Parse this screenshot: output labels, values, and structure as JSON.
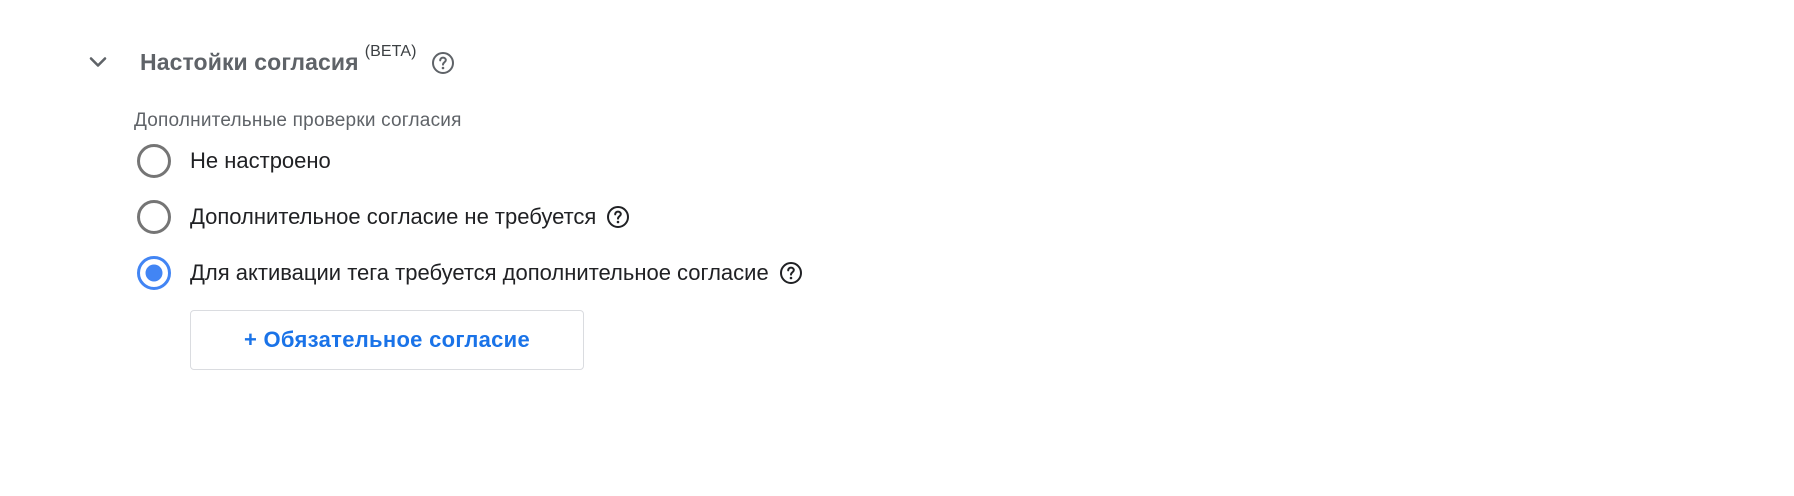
{
  "section": {
    "title": "Настойки согласия",
    "badge": "(BETA)",
    "expanded": true,
    "icons": {
      "toggle": "chevron-down-icon",
      "help": "help-circle-icon"
    }
  },
  "consent_checks": {
    "label": "Дополнительные проверки согласия",
    "selected_index": 2,
    "options": [
      {
        "label": "Не настроено",
        "selected": false,
        "has_help": false
      },
      {
        "label": "Дополнительное согласие не требуется",
        "selected": false,
        "has_help": true
      },
      {
        "label": "Для активации тега требуется дополнительное согласие",
        "selected": true,
        "has_help": true
      }
    ],
    "add_button": {
      "label": "+ Обязательное согласие"
    }
  },
  "colors": {
    "accent": "#1a73e8",
    "radio_selected": "#4285f4",
    "radio_unselected": "#757575",
    "title": "#5f6368"
  }
}
